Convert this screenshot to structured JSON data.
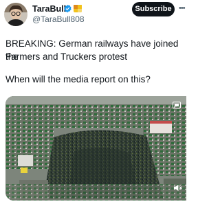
{
  "author": {
    "display_name": "TaraBull",
    "handle": "@TaraBull808"
  },
  "actions": {
    "subscribe_label": "Subscribe",
    "more_icon": "more-horizontal-icon"
  },
  "tweet": {
    "line1": "BREAKING: German railways have joined the",
    "line2": "Farmers and Truckers protest",
    "line3": "When will the media report on this?"
  },
  "media": {
    "type": "video",
    "description_icons": [
      "gif-icon",
      "mute-icon"
    ]
  },
  "colors": {
    "text": "#0f1419",
    "secondary": "#536471",
    "verified": "#1d9bf0",
    "subscribe_bg": "#0f1419"
  }
}
